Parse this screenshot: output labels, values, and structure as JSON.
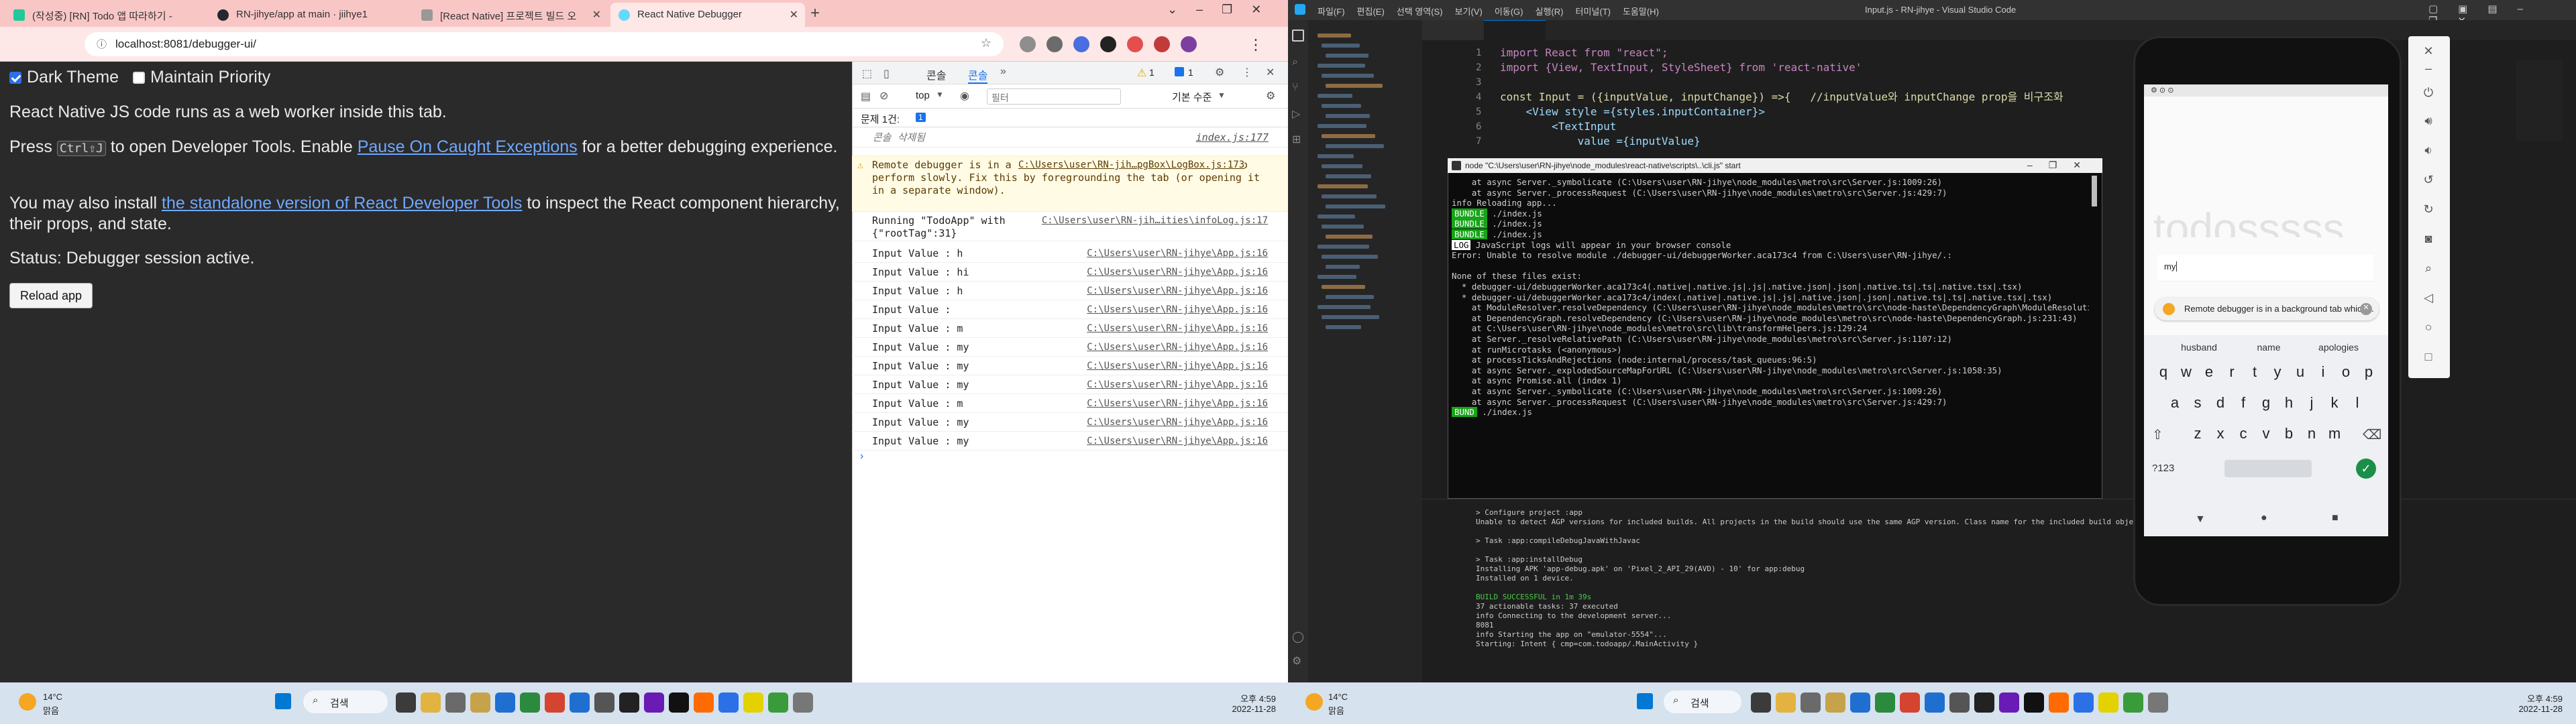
{
  "browser": {
    "tabs": [
      {
        "label": "(작성중) [RN] Todo 앱 따라하기 -"
      },
      {
        "label": "RN-jihye/app at main · jiihye1"
      },
      {
        "label": "[React Native] 프로젝트 빌드 오"
      },
      {
        "label": "React Native Debugger"
      }
    ],
    "url": "localhost:8081/debugger-ui/"
  },
  "debugger_page": {
    "dark_theme_label": "Dark Theme",
    "maintain_priority_label": "Maintain Priority",
    "intro": "React Native JS code runs as a web worker inside this tab.",
    "press": "Press",
    "shortcut": "Ctrl⇧J",
    "press_tail": "to open Developer Tools. Enable",
    "pause_link": "Pause On Caught Exceptions",
    "press_tail2": "for a better debugging experience.",
    "install_pre": "You may also install",
    "install_link": "the standalone version of React Developer Tools",
    "install_tail": "to inspect the React component hierarchy, their props, and state.",
    "status": "Status: Debugger session active.",
    "reload_button": "Reload app"
  },
  "devtools": {
    "tab_console": "콘솔",
    "tab_sources": "콘솔",
    "warn_badge": "1",
    "msg_badge": "1",
    "context": "top",
    "filter_placeholder": "필터",
    "level": "기본 수준",
    "issues": "문제 1건:",
    "issues_count": "1",
    "cleared": "콘솔 삭제됨",
    "cleared_src": "index.js:177",
    "warning_text": "Remote debugger is in a background tab which may cause apps to perform slowly. Fix this by foregrounding the tab (or opening it in a separate window).",
    "warning_src": "C:\\Users\\user\\RN-jih…pgBox\\LogBox.js:173",
    "running_text": "Running \"TodoApp\" with {\"rootTag\":31}",
    "running_src": "C:\\Users\\user\\RN-jih…ities\\infoLog.js:17",
    "log_src": "C:\\Users\\user\\RN-jihye\\App.js:16",
    "logs": [
      "Input Value :  h",
      "Input Value :  hi",
      "Input Value :  h",
      "Input Value : ",
      "Input Value :  m",
      "Input Value :  my",
      "Input Value :  my",
      "Input Value :  my",
      "Input Value :  m",
      "Input Value :  my",
      "Input Value :  my"
    ]
  },
  "taskbar": {
    "weather_temp": "14°C",
    "weather_desc": "맑음",
    "search": "검색",
    "time": "오후 4:59",
    "date": "2022-11-28"
  },
  "vscode": {
    "title": "Input.js - RN-jihye - Visual Studio Code",
    "menu": [
      "파일(F)",
      "편집(E)",
      "선택 영역(S)",
      "보기(V)",
      "이동(G)",
      "실행(R)",
      "터미널(T)",
      "도움말(H)"
    ],
    "code_lines": [
      "import React from \"react\";",
      "import {View, TextInput, StyleSheet} from 'react-native'",
      "",
      "const Input = ({inputValue, inputChange}) =>{   //inputValue와 inputChange prop을 비구조화",
      "    <View style ={styles.inputContainer}>",
      "        <TextInput",
      "            value ={inputValue}"
    ]
  },
  "terminal": {
    "title": "node  \"C:\\Users\\user\\RN-jihye\\node_modules\\react-native\\scripts\\..\\cli.js\" start",
    "lines": [
      "    at async Server._symbolicate (C:\\Users\\user\\RN-jihye\\node_modules\\metro\\src\\Server.js:1009:26)",
      "    at async Server._processRequest (C:\\Users\\user\\RN-jihye\\node_modules\\metro\\src\\Server.js:429:7)",
      "info Reloading app...",
      "./index.js",
      "./index.js",
      "./index.js",
      "JavaScript logs will appear in your browser console",
      "Error: Unable to resolve module ./debugger-ui/debuggerWorker.aca173c4 from C:\\Users\\user\\RN-jihye/.:",
      "",
      "None of these files exist:",
      "  * debugger-ui/debuggerWorker.aca173c4(.native|.native.js|.js|.native.json|.json|.native.ts|.ts|.native.tsx|.tsx)",
      "  * debugger-ui/debuggerWorker.aca173c4/index(.native|.native.js|.js|.native.json|.json|.native.ts|.ts|.native.tsx|.tsx)",
      "    at ModuleResolver.resolveDependency (C:\\Users\\user\\RN-jihye\\node_modules\\metro\\src\\node-haste\\DependencyGraph\\ModuleResolution.js:136:15)",
      "    at DependencyGraph.resolveDependency (C:\\Users\\user\\RN-jihye\\node_modules\\metro\\src\\node-haste\\DependencyGraph.js:231:43)",
      "    at C:\\Users\\user\\RN-jihye\\node_modules\\metro\\src\\lib\\transformHelpers.js:129:24",
      "    at Server._resolveRelativePath (C:\\Users\\user\\RN-jihye\\node_modules\\metro\\src\\Server.js:1107:12)",
      "    at runMicrotasks (<anonymous>)",
      "    at processTicksAndRejections (node:internal/process/task_queues:96:5)",
      "    at async Server._explodedSourceMapForURL (C:\\Users\\user\\RN-jihye\\node_modules\\metro\\src\\Server.js:1058:35)",
      "    at async Promise.all (index 1)",
      "    at async Server._symbolicate (C:\\Users\\user\\RN-jihye\\node_modules\\metro\\src\\Server.js:1009:26)",
      "    at async Server._processRequest (C:\\Users\\user\\RN-jihye\\node_modules\\metro\\src\\Server.js:429:7)",
      "./index.js"
    ],
    "bundle_tag": "BUNDLE",
    "log_tag": "LOG",
    "bundle_done_tag": "BUND"
  },
  "build_output": [
    "> Configure project :app",
    "Unable to detect AGP versions for included builds. All projects in the build should use the same AGP version. Class name for the included build object: org.grad",
    "> Task :app:compileDebugJavaWithJavac",
    "> Task :app:installDebug",
    "Installing APK 'app-debug.apk' on 'Pixel_2_API_29(AVD) - 10' for app:debug",
    "Installed on 1 device.",
    "BUILD SUCCESSFUL in 1m 39s",
    "37 actionable tasks: 37 executed",
    "info Connecting to the development server...",
    "8081",
    "info Starting the app on \"emulator-5554\"...",
    "Starting: Intent { cmp=com.todoapp/.MainActivity }"
  ],
  "emulator": {
    "app_title": "todosssss",
    "input_text": "my",
    "toast": "Remote debugger is in a background tab which...",
    "suggestions": [
      "husband",
      "name",
      "apologies"
    ],
    "row1": [
      "q",
      "w",
      "e",
      "r",
      "t",
      "y",
      "u",
      "i",
      "o",
      "p"
    ],
    "row2": [
      "a",
      "s",
      "d",
      "f",
      "g",
      "h",
      "j",
      "k",
      "l"
    ],
    "row3": [
      "z",
      "x",
      "c",
      "v",
      "b",
      "n",
      "m"
    ],
    "numkey": "?123"
  },
  "colors": {
    "accent": "#2b70e6",
    "bundle_green": "#17a418",
    "tab_bar": "#f9c6c6"
  }
}
